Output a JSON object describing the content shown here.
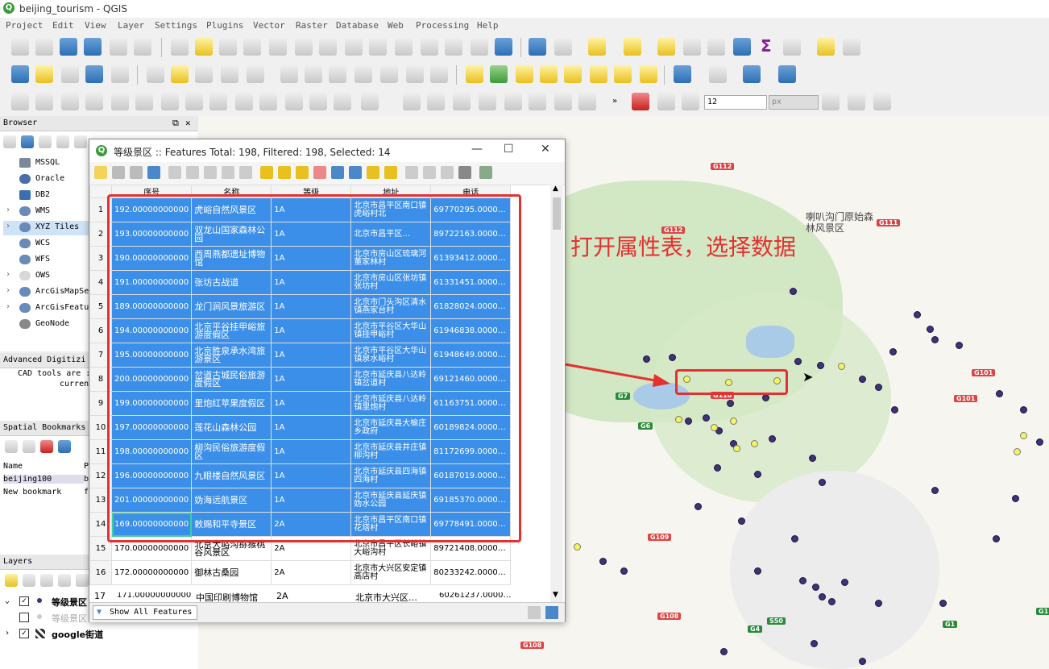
{
  "window": {
    "title": "beijing_tourism - QGIS"
  },
  "menu": [
    "Project",
    "Edit",
    "View",
    "Layer",
    "Settings",
    "Plugins",
    "Vector",
    "Raster",
    "Database",
    "Web",
    "Processing",
    "Help"
  ],
  "toolbar3": {
    "size_value": "12",
    "unit": "px"
  },
  "browser": {
    "title": "Browser",
    "items": [
      "MSSQL",
      "Oracle",
      "DB2",
      "WMS",
      "XYZ Tiles",
      "WCS",
      "WFS",
      "OWS",
      "ArcGisMapSe",
      "ArcGisFeatu",
      "GeoNode"
    ]
  },
  "advanced": {
    "title": "Advanced Digitizi",
    "line1": "CAD tools are :",
    "line2": "curren"
  },
  "bookmarks": {
    "title": "Spatial Bookmarks",
    "col_name": "Name",
    "col_b": "P",
    "rows": [
      {
        "name": "beijing100",
        "b": "b"
      },
      {
        "name": "New bookmark",
        "b": "f"
      }
    ]
  },
  "layers": {
    "title": "Layers",
    "items": [
      {
        "label": "等级景区",
        "checked": true
      },
      {
        "label": "等级景区",
        "checked": false
      },
      {
        "label": "google街道",
        "checked": true
      }
    ]
  },
  "attr_table": {
    "title": "等级景区 :: Features Total: 198, Filtered: 198, Selected: 14",
    "columns": [
      "序号",
      "名称",
      "等级",
      "地址",
      "电话"
    ],
    "rows": [
      {
        "n": "1",
        "id": "192.00000000000",
        "name": "虎峪自然风景区",
        "level": "1A",
        "addr": "北京市昌平区南口镇虎峪村北",
        "tel": "69770295.0000…",
        "selected": true
      },
      {
        "n": "2",
        "id": "193.00000000000",
        "name": "双龙山国家森林公园",
        "level": "1A",
        "addr": "北京市昌平区…",
        "tel": "89722163.0000…",
        "selected": true
      },
      {
        "n": "3",
        "id": "190.00000000000",
        "name": "西周燕都遗址博物馆",
        "level": "1A",
        "addr": "北京市房山区琉璃河董家林村",
        "tel": "61393412.0000…",
        "selected": true
      },
      {
        "n": "4",
        "id": "191.00000000000",
        "name": "张坊古战道",
        "level": "1A",
        "addr": "北京市房山区张坊镇张坊村",
        "tel": "61331451.0000…",
        "selected": true
      },
      {
        "n": "5",
        "id": "189.00000000000",
        "name": "龙门涧风景旅游区",
        "level": "1A",
        "addr": "北京市门头沟区清水镇燕家台村",
        "tel": "61828024.0000…",
        "selected": true
      },
      {
        "n": "6",
        "id": "194.00000000000",
        "name": "北京平谷挂甲峪旅游度假区",
        "level": "1A",
        "addr": "北京市平谷区大华山镇挂甲峪村",
        "tel": "61946838.0000…",
        "selected": true
      },
      {
        "n": "7",
        "id": "195.00000000000",
        "name": "北京胜泉承水湾旅游景区",
        "level": "1A",
        "addr": "北京市平谷区大华山镇泉水峪村",
        "tel": "61948649.0000…",
        "selected": true
      },
      {
        "n": "8",
        "id": "200.00000000000",
        "name": "岔道古城民俗旅游度假区",
        "level": "1A",
        "addr": "北京市延庆县八达岭镇岔道村",
        "tel": "69121460.0000…",
        "selected": true
      },
      {
        "n": "9",
        "id": "199.00000000000",
        "name": "里炮红苹果度假区",
        "level": "1A",
        "addr": "北京市延庆县八达岭镇里炮村",
        "tel": "61163751.0000…",
        "selected": true
      },
      {
        "n": "10",
        "id": "197.00000000000",
        "name": "莲花山森林公园",
        "level": "1A",
        "addr": "北京市延庆县大榆庄乡政府",
        "tel": "60189824.0000…",
        "selected": true
      },
      {
        "n": "11",
        "id": "198.00000000000",
        "name": "柳沟民俗旅游度假区",
        "level": "1A",
        "addr": "北京市延庆县井庄镇柳沟村",
        "tel": "81172699.0000…",
        "selected": true
      },
      {
        "n": "12",
        "id": "196.00000000000",
        "name": "九眼楼自然风景区",
        "level": "1A",
        "addr": "北京市延庆县四海镇四海村",
        "tel": "60187019.0000…",
        "selected": true
      },
      {
        "n": "13",
        "id": "201.00000000000",
        "name": "妫海远航景区",
        "level": "1A",
        "addr": "北京市延庆县延庆镇妫水公园",
        "tel": "69185370.0000…",
        "selected": true
      },
      {
        "n": "14",
        "id": "169.00000000000",
        "name": "敕赐和平寺景区",
        "level": "2A",
        "addr": "北京市昌平区南口镇花塔村",
        "tel": "69778491.0000…",
        "selected": true
      },
      {
        "n": "15",
        "id": "170.00000000000",
        "name": "北京大峪沟猕猴桃谷风景区",
        "level": "2A",
        "addr": "北京市昌平区长峪镇大峪沟村",
        "tel": "89721408.0000…",
        "selected": false
      },
      {
        "n": "16",
        "id": "172.00000000000",
        "name": "御林古桑园",
        "level": "2A",
        "addr": "北京市大兴区安定镇高店村",
        "tel": "80233242.0000…",
        "selected": false
      },
      {
        "n": "17",
        "id": "171.00000000000",
        "name": "中国印刷博物馆",
        "level": "2A",
        "addr": "北京市大兴区…",
        "tel": "60261237.0000…",
        "selected": false
      }
    ],
    "show_all": "Show All Features"
  },
  "annotation": "打开属性表，选择数据",
  "map_labels": {
    "g112": "G112",
    "g112b": "G112",
    "g111": "G111",
    "g101": "G101",
    "g101b": "G101",
    "g7": "G7",
    "g6": "G6",
    "g110": "G110",
    "g109": "G109",
    "g108": "G108",
    "g108b": "G108",
    "g4": "G4",
    "s50": "S50",
    "g1": "G1",
    "g1b": "G1",
    "forest": "喇叭沟门原始森林风景区"
  },
  "colors": {
    "selection": "#3b8fe8",
    "annotation": "#e53030",
    "point": "#3f3275",
    "point_selected": "#f5f55a"
  }
}
